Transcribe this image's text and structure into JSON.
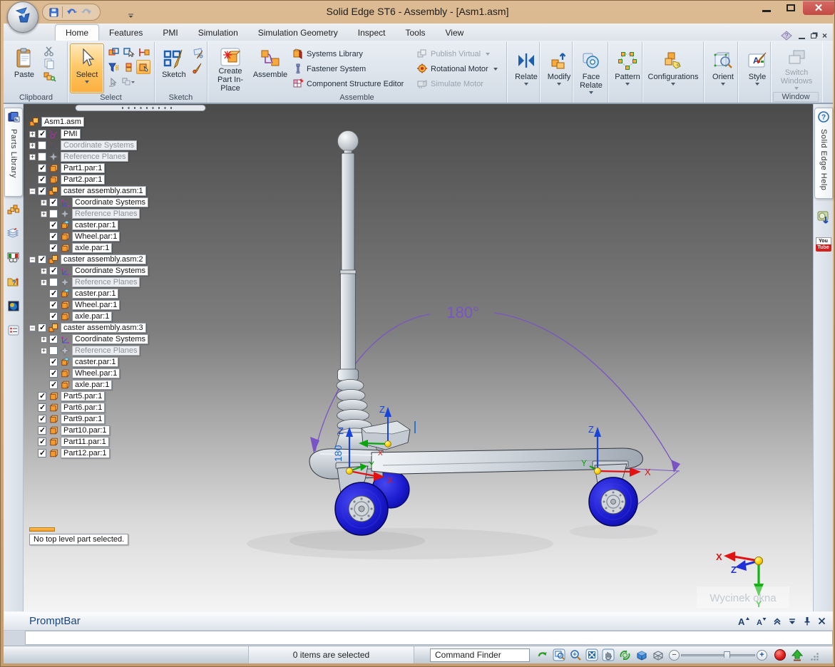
{
  "window": {
    "title": "Solid Edge ST6 - Assembly - [Asm1.asm]"
  },
  "quick_access": {
    "buttons": [
      "save",
      "undo",
      "redo",
      "customize"
    ]
  },
  "tabs": {
    "active": "Home",
    "items": [
      "Home",
      "Features",
      "PMI",
      "Simulation",
      "Simulation Geometry",
      "Inspect",
      "Tools",
      "View"
    ]
  },
  "ribbon": {
    "clipboard": {
      "paste": "Paste",
      "label": "Clipboard"
    },
    "select": {
      "button": "Select",
      "label": "Select",
      "grid": [
        "box-select",
        "select-visible",
        "clamp",
        "filter",
        "component",
        "activate",
        "pointer-gray",
        "options"
      ]
    },
    "sketch": {
      "button": "Sketch",
      "label": "Sketch"
    },
    "assemble": {
      "create_part": "Create Part In-Place",
      "assemble": "Assemble",
      "label": "Assemble",
      "col1": [
        "Systems Library",
        "Fastener System",
        "Component Structure Editor"
      ],
      "col2": [
        {
          "label": "Publish Virtual",
          "disabled": true,
          "dropdown": true
        },
        {
          "label": "Rotational Motor",
          "disabled": false,
          "dropdown": true
        },
        {
          "label": "Simulate Motor",
          "disabled": true,
          "dropdown": false
        }
      ]
    },
    "relate": "Relate",
    "modify": "Modify",
    "face_relate": "Face Relate",
    "pattern": "Pattern",
    "configurations": "Configurations",
    "orient": "Orient",
    "style": "Style",
    "switch_windows": "Switch Windows",
    "window_label": "Window"
  },
  "left_rail": {
    "tab": "Parts Library",
    "icons": [
      "blocks",
      "layers",
      "medal",
      "folder-help",
      "preview",
      "notes"
    ]
  },
  "right_rail": {
    "tab": "Solid Edge Help",
    "youtube_top": "You",
    "youtube_bottom": "Tube"
  },
  "tree": {
    "root": "Asm1.asm",
    "status": "No top level part selected.",
    "items": [
      {
        "l": 1,
        "e": "+",
        "c": 1,
        "g": 0,
        "i": "pmi",
        "t": "PMI"
      },
      {
        "l": 1,
        "e": "+",
        "c": 0,
        "g": 1,
        "i": "csys",
        "t": "Coordinate Systems"
      },
      {
        "l": 1,
        "e": "+",
        "c": 0,
        "g": 1,
        "i": "ref",
        "t": "Reference Planes"
      },
      {
        "l": 1,
        "e": "",
        "c": 1,
        "g": 0,
        "i": "part",
        "t": "Part1.par:1"
      },
      {
        "l": 1,
        "e": "",
        "c": 1,
        "g": 0,
        "i": "part",
        "t": "Part2.par:1"
      },
      {
        "l": 1,
        "e": "-",
        "c": 1,
        "g": 0,
        "i": "asm",
        "t": "caster assembly.asm:1"
      },
      {
        "l": 2,
        "e": "+",
        "c": 1,
        "g": 0,
        "i": "csys",
        "t": "Coordinate Systems"
      },
      {
        "l": 2,
        "e": "+",
        "c": 0,
        "g": 1,
        "i": "ref",
        "t": "Reference Planes"
      },
      {
        "l": 2,
        "e": "",
        "c": 1,
        "g": 0,
        "i": "partc",
        "t": "caster.par:1"
      },
      {
        "l": 2,
        "e": "",
        "c": 1,
        "g": 0,
        "i": "part",
        "t": "Wheel.par:1"
      },
      {
        "l": 2,
        "e": "",
        "c": 1,
        "g": 0,
        "i": "part",
        "t": "axle.par:1"
      },
      {
        "l": 1,
        "e": "-",
        "c": 1,
        "g": 0,
        "i": "asm",
        "t": "caster assembly.asm:2"
      },
      {
        "l": 2,
        "e": "+",
        "c": 1,
        "g": 0,
        "i": "csys",
        "t": "Coordinate Systems"
      },
      {
        "l": 2,
        "e": "+",
        "c": 0,
        "g": 1,
        "i": "ref",
        "t": "Reference Planes"
      },
      {
        "l": 2,
        "e": "",
        "c": 1,
        "g": 0,
        "i": "partc",
        "t": "caster.par:1"
      },
      {
        "l": 2,
        "e": "",
        "c": 1,
        "g": 0,
        "i": "part",
        "t": "Wheel.par:1"
      },
      {
        "l": 2,
        "e": "",
        "c": 1,
        "g": 0,
        "i": "part",
        "t": "axle.par:1"
      },
      {
        "l": 1,
        "e": "-",
        "c": 1,
        "g": 0,
        "i": "asm",
        "t": "caster assembly.asm:3"
      },
      {
        "l": 2,
        "e": "+",
        "c": 1,
        "g": 0,
        "i": "csys",
        "t": "Coordinate Systems"
      },
      {
        "l": 2,
        "e": "+",
        "c": 0,
        "g": 1,
        "i": "ref",
        "t": "Reference Planes"
      },
      {
        "l": 2,
        "e": "",
        "c": 1,
        "g": 0,
        "i": "partc",
        "t": "caster.par:1"
      },
      {
        "l": 2,
        "e": "",
        "c": 1,
        "g": 0,
        "i": "part",
        "t": "Wheel.par:1"
      },
      {
        "l": 2,
        "e": "",
        "c": 1,
        "g": 0,
        "i": "part",
        "t": "axle.par:1"
      },
      {
        "l": 1,
        "e": "",
        "c": 1,
        "g": 0,
        "i": "part",
        "t": "Part5.par:1"
      },
      {
        "l": 1,
        "e": "",
        "c": 1,
        "g": 0,
        "i": "part",
        "t": "Part6.par:1"
      },
      {
        "l": 1,
        "e": "",
        "c": 1,
        "g": 0,
        "i": "part",
        "t": "Part9.par:1"
      },
      {
        "l": 1,
        "e": "",
        "c": 1,
        "g": 0,
        "i": "part",
        "t": "Part10.par:1"
      },
      {
        "l": 1,
        "e": "",
        "c": 1,
        "g": 0,
        "i": "part",
        "t": "Part11.par:1"
      },
      {
        "l": 1,
        "e": "",
        "c": 1,
        "g": 0,
        "i": "part",
        "t": "Part12.par:1"
      }
    ]
  },
  "viewport": {
    "angle_label": "180°",
    "inline_value": "180",
    "watermark": "Wycinek okna",
    "axis": {
      "x": "X",
      "y": "Y",
      "z": "Z"
    }
  },
  "promptbar": {
    "title": "PromptBar",
    "buttons": [
      "font-increase",
      "font-decrease",
      "collapse-up",
      "expand-down",
      "pin",
      "close"
    ]
  },
  "statusbar": {
    "selection": "0 items are selected",
    "command_finder": "Command Finder",
    "tools": [
      "refresh",
      "zoom-area",
      "zoom",
      "fit",
      "pan",
      "rotate",
      "shaded-views",
      "view-styles"
    ],
    "slider_min": "−",
    "slider_max": "+"
  }
}
